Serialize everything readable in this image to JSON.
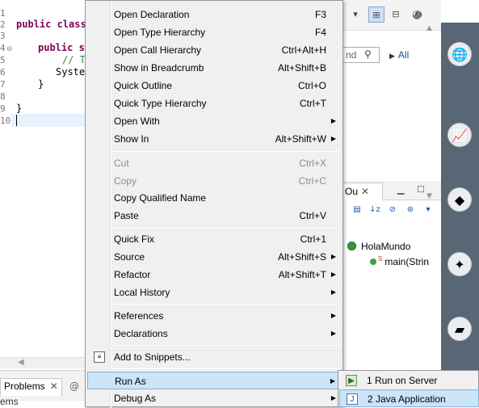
{
  "editor": {
    "line_numbers": [
      "1",
      "2",
      "3",
      "4",
      "5",
      "6",
      "7",
      "8",
      "9",
      "10"
    ],
    "lines": [
      {
        "kw": "",
        "text": ""
      },
      {
        "kw": "public class",
        "text": ""
      },
      {
        "kw": "",
        "text": ""
      },
      {
        "kw": "public st",
        "text": ""
      },
      {
        "kw": "",
        "text": "// To"
      },
      {
        "kw": "",
        "text": "Syster"
      },
      {
        "kw": "",
        "text": "}"
      },
      {
        "kw": "",
        "text": ""
      },
      {
        "kw": "",
        "text": "}"
      },
      {
        "kw": "",
        "text": ""
      }
    ]
  },
  "bottom": {
    "problems_tab": "Problems",
    "close_glyph": "✕",
    "at_glyph": "@",
    "items_label": "ems"
  },
  "right": {
    "search_text": "nd",
    "all_label": "All",
    "outline_tab": "Ou",
    "outline_class": "HolaMundo",
    "outline_method": "main(Strin",
    "static_marker": "S"
  },
  "context_menu": {
    "items": [
      {
        "label": "Open Declaration",
        "shortcut": "F3",
        "submenu": false,
        "disabled": false
      },
      {
        "label": "Open Type Hierarchy",
        "shortcut": "F4",
        "submenu": false,
        "disabled": false
      },
      {
        "label": "Open Call Hierarchy",
        "shortcut": "Ctrl+Alt+H",
        "submenu": false,
        "disabled": false
      },
      {
        "label": "Show in Breadcrumb",
        "shortcut": "Alt+Shift+B",
        "submenu": false,
        "disabled": false
      },
      {
        "label": "Quick Outline",
        "shortcut": "Ctrl+O",
        "submenu": false,
        "disabled": false
      },
      {
        "label": "Quick Type Hierarchy",
        "shortcut": "Ctrl+T",
        "submenu": false,
        "disabled": false
      },
      {
        "label": "Open With",
        "shortcut": "",
        "submenu": true,
        "disabled": false
      },
      {
        "label": "Show In",
        "shortcut": "Alt+Shift+W",
        "submenu": true,
        "disabled": false
      },
      {
        "label": "Cut",
        "shortcut": "Ctrl+X",
        "submenu": false,
        "disabled": true
      },
      {
        "label": "Copy",
        "shortcut": "Ctrl+C",
        "submenu": false,
        "disabled": true
      },
      {
        "label": "Copy Qualified Name",
        "shortcut": "",
        "submenu": false,
        "disabled": false
      },
      {
        "label": "Paste",
        "shortcut": "Ctrl+V",
        "submenu": false,
        "disabled": false
      },
      {
        "label": "Quick Fix",
        "shortcut": "Ctrl+1",
        "submenu": false,
        "disabled": false
      },
      {
        "label": "Source",
        "shortcut": "Alt+Shift+S",
        "submenu": true,
        "disabled": false
      },
      {
        "label": "Refactor",
        "shortcut": "Alt+Shift+T",
        "submenu": true,
        "disabled": false
      },
      {
        "label": "Local History",
        "shortcut": "",
        "submenu": true,
        "disabled": false
      },
      {
        "label": "References",
        "shortcut": "",
        "submenu": true,
        "disabled": false
      },
      {
        "label": "Declarations",
        "shortcut": "",
        "submenu": true,
        "disabled": false
      },
      {
        "label": "Add to Snippets...",
        "shortcut": "",
        "submenu": false,
        "disabled": false
      },
      {
        "label": "Run As",
        "shortcut": "",
        "submenu": true,
        "disabled": false,
        "highlighted": true
      },
      {
        "label": "Debug As",
        "shortcut": "",
        "submenu": true,
        "disabled": false
      }
    ],
    "submenu_arrow": "▶"
  },
  "run_as_submenu": {
    "items": [
      {
        "label": "1 Run on Server",
        "icon": "run-on-server-icon",
        "highlighted": false
      },
      {
        "label": "2 Java Application",
        "icon": "java-application-icon",
        "highlighted": true
      }
    ]
  },
  "colors": {
    "menu_bg": "#f0f0f0",
    "highlight_bg": "#cce4f7",
    "highlight_border": "#7eb4ea",
    "keyword": "#7f0055",
    "comment": "#3f7f5f",
    "dark_strip": "#586675"
  }
}
